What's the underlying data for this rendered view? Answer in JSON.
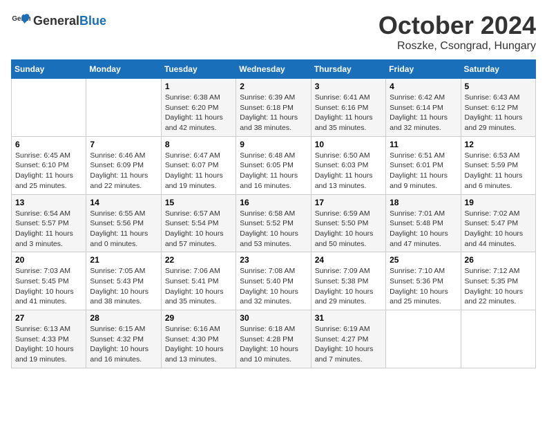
{
  "logo": {
    "general": "General",
    "blue": "Blue"
  },
  "header": {
    "month": "October 2024",
    "location": "Roszke, Csongrad, Hungary"
  },
  "weekdays": [
    "Sunday",
    "Monday",
    "Tuesday",
    "Wednesday",
    "Thursday",
    "Friday",
    "Saturday"
  ],
  "weeks": [
    [
      {
        "day": "",
        "detail": ""
      },
      {
        "day": "",
        "detail": ""
      },
      {
        "day": "1",
        "detail": "Sunrise: 6:38 AM\nSunset: 6:20 PM\nDaylight: 11 hours and 42 minutes."
      },
      {
        "day": "2",
        "detail": "Sunrise: 6:39 AM\nSunset: 6:18 PM\nDaylight: 11 hours and 38 minutes."
      },
      {
        "day": "3",
        "detail": "Sunrise: 6:41 AM\nSunset: 6:16 PM\nDaylight: 11 hours and 35 minutes."
      },
      {
        "day": "4",
        "detail": "Sunrise: 6:42 AM\nSunset: 6:14 PM\nDaylight: 11 hours and 32 minutes."
      },
      {
        "day": "5",
        "detail": "Sunrise: 6:43 AM\nSunset: 6:12 PM\nDaylight: 11 hours and 29 minutes."
      }
    ],
    [
      {
        "day": "6",
        "detail": "Sunrise: 6:45 AM\nSunset: 6:10 PM\nDaylight: 11 hours and 25 minutes."
      },
      {
        "day": "7",
        "detail": "Sunrise: 6:46 AM\nSunset: 6:09 PM\nDaylight: 11 hours and 22 minutes."
      },
      {
        "day": "8",
        "detail": "Sunrise: 6:47 AM\nSunset: 6:07 PM\nDaylight: 11 hours and 19 minutes."
      },
      {
        "day": "9",
        "detail": "Sunrise: 6:48 AM\nSunset: 6:05 PM\nDaylight: 11 hours and 16 minutes."
      },
      {
        "day": "10",
        "detail": "Sunrise: 6:50 AM\nSunset: 6:03 PM\nDaylight: 11 hours and 13 minutes."
      },
      {
        "day": "11",
        "detail": "Sunrise: 6:51 AM\nSunset: 6:01 PM\nDaylight: 11 hours and 9 minutes."
      },
      {
        "day": "12",
        "detail": "Sunrise: 6:53 AM\nSunset: 5:59 PM\nDaylight: 11 hours and 6 minutes."
      }
    ],
    [
      {
        "day": "13",
        "detail": "Sunrise: 6:54 AM\nSunset: 5:57 PM\nDaylight: 11 hours and 3 minutes."
      },
      {
        "day": "14",
        "detail": "Sunrise: 6:55 AM\nSunset: 5:56 PM\nDaylight: 11 hours and 0 minutes."
      },
      {
        "day": "15",
        "detail": "Sunrise: 6:57 AM\nSunset: 5:54 PM\nDaylight: 10 hours and 57 minutes."
      },
      {
        "day": "16",
        "detail": "Sunrise: 6:58 AM\nSunset: 5:52 PM\nDaylight: 10 hours and 53 minutes."
      },
      {
        "day": "17",
        "detail": "Sunrise: 6:59 AM\nSunset: 5:50 PM\nDaylight: 10 hours and 50 minutes."
      },
      {
        "day": "18",
        "detail": "Sunrise: 7:01 AM\nSunset: 5:48 PM\nDaylight: 10 hours and 47 minutes."
      },
      {
        "day": "19",
        "detail": "Sunrise: 7:02 AM\nSunset: 5:47 PM\nDaylight: 10 hours and 44 minutes."
      }
    ],
    [
      {
        "day": "20",
        "detail": "Sunrise: 7:03 AM\nSunset: 5:45 PM\nDaylight: 10 hours and 41 minutes."
      },
      {
        "day": "21",
        "detail": "Sunrise: 7:05 AM\nSunset: 5:43 PM\nDaylight: 10 hours and 38 minutes."
      },
      {
        "day": "22",
        "detail": "Sunrise: 7:06 AM\nSunset: 5:41 PM\nDaylight: 10 hours and 35 minutes."
      },
      {
        "day": "23",
        "detail": "Sunrise: 7:08 AM\nSunset: 5:40 PM\nDaylight: 10 hours and 32 minutes."
      },
      {
        "day": "24",
        "detail": "Sunrise: 7:09 AM\nSunset: 5:38 PM\nDaylight: 10 hours and 29 minutes."
      },
      {
        "day": "25",
        "detail": "Sunrise: 7:10 AM\nSunset: 5:36 PM\nDaylight: 10 hours and 25 minutes."
      },
      {
        "day": "26",
        "detail": "Sunrise: 7:12 AM\nSunset: 5:35 PM\nDaylight: 10 hours and 22 minutes."
      }
    ],
    [
      {
        "day": "27",
        "detail": "Sunrise: 6:13 AM\nSunset: 4:33 PM\nDaylight: 10 hours and 19 minutes."
      },
      {
        "day": "28",
        "detail": "Sunrise: 6:15 AM\nSunset: 4:32 PM\nDaylight: 10 hours and 16 minutes."
      },
      {
        "day": "29",
        "detail": "Sunrise: 6:16 AM\nSunset: 4:30 PM\nDaylight: 10 hours and 13 minutes."
      },
      {
        "day": "30",
        "detail": "Sunrise: 6:18 AM\nSunset: 4:28 PM\nDaylight: 10 hours and 10 minutes."
      },
      {
        "day": "31",
        "detail": "Sunrise: 6:19 AM\nSunset: 4:27 PM\nDaylight: 10 hours and 7 minutes."
      },
      {
        "day": "",
        "detail": ""
      },
      {
        "day": "",
        "detail": ""
      }
    ]
  ]
}
